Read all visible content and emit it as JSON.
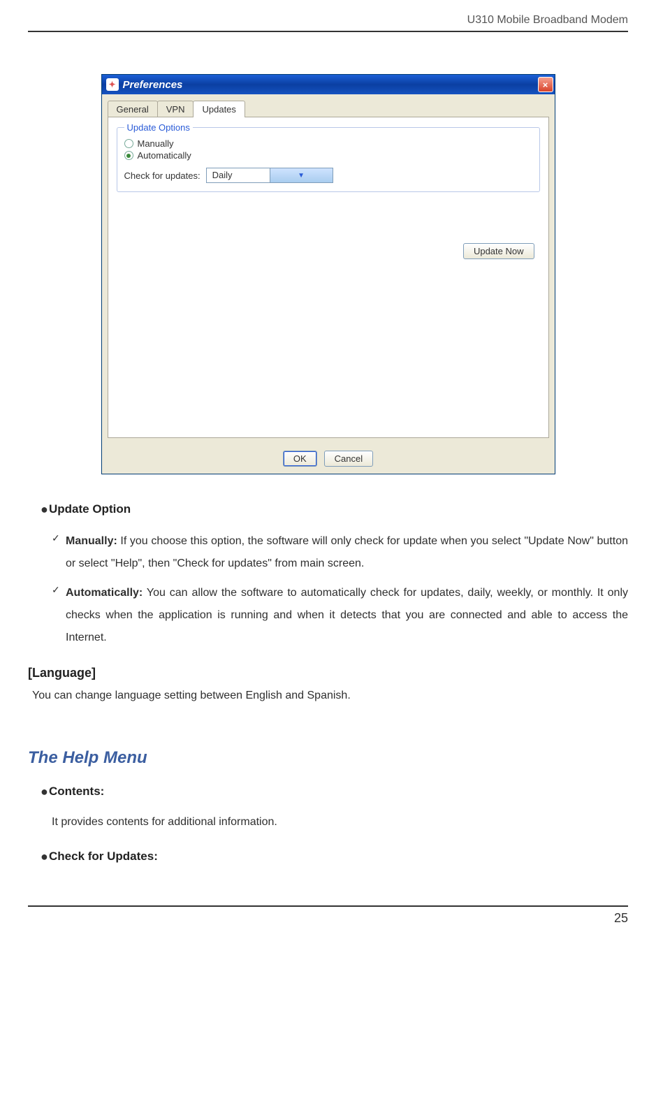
{
  "header": {
    "product": "U310 Mobile Broadband Modem"
  },
  "page_number": "25",
  "pref_window": {
    "title": "Preferences",
    "close": "×",
    "tabs": {
      "general": "General",
      "vpn": "VPN",
      "updates": "Updates"
    },
    "group": {
      "legend": "Update Options",
      "manually": "Manually",
      "automatically": "Automatically",
      "check_label": "Check for updates:",
      "combo_value": "Daily"
    },
    "update_now": "Update Now",
    "ok": "OK",
    "cancel": "Cancel"
  },
  "doc": {
    "update_option_title": "Update Option",
    "manually_label": "Manually:",
    "manually_text": " If you choose this option, the software will only check for update when you select \"Update Now\" button or select \"Help\", then \"Check for updates\" from main screen.",
    "automatically_label": "Automatically:",
    "automatically_text": " You can allow the software to automatically check for updates, daily, weekly, or monthly. It only checks when the application is running and when it detects that you are connected and able to access the Internet.",
    "language_h": "[Language]",
    "language_text": "You can change language setting between English and Spanish.",
    "help_h": "The Help Menu",
    "contents_title": "Contents:",
    "contents_text": "It provides contents for additional information.",
    "check_updates_title": "Check for Updates:"
  }
}
